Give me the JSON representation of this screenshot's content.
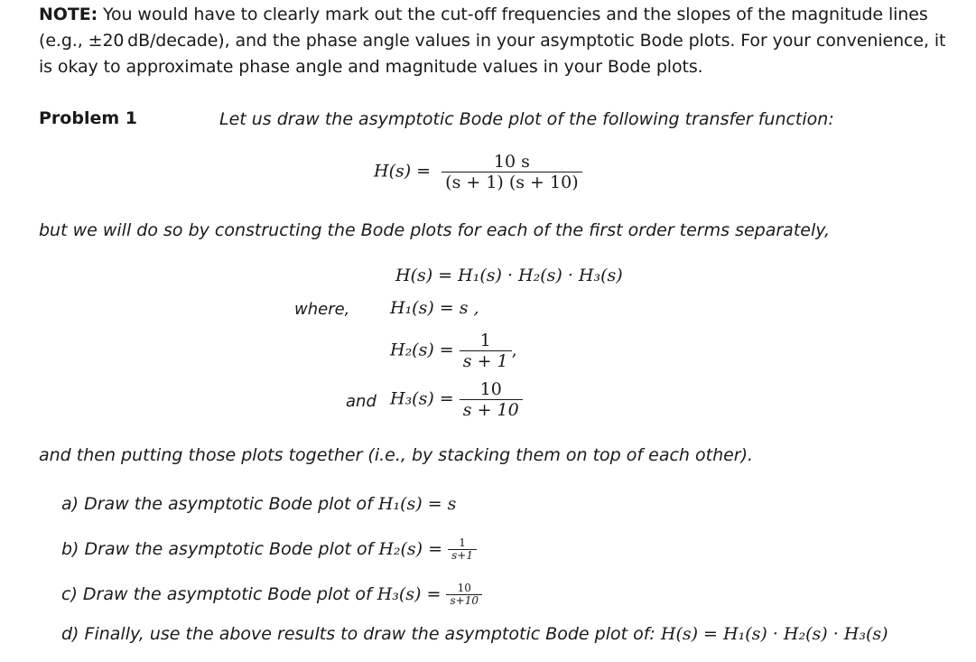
{
  "note": {
    "label": "NOTE:",
    "text": "You would have to clearly mark out the cut-off frequencies and the slopes of the magnitude lines (e.g., ±20 dB/decade), and the phase angle values in your asymptotic Bode plots. For your convenience, it is okay to approximate phase angle and magnitude values in your Bode plots."
  },
  "problem": {
    "label": "Problem 1",
    "intro": "Let us draw the asymptotic Bode plot of the following transfer function:",
    "main_eq": {
      "lhs": "H(s) =",
      "numerator": "10 s",
      "denominator": "(s + 1) (s + 10)"
    },
    "middle_text": "but we will do so by constructing the Bode plots for each of the first order terms separately,",
    "product_eq": "H(s) = H₁(s) · H₂(s) · H₃(s)",
    "where_label": "where,",
    "h1_eq": "H₁(s) = s ,",
    "h2": {
      "lhs": "H₂(s) =",
      "numerator": "1",
      "denominator": "s + 1",
      "suffix": ","
    },
    "and_label": "and",
    "h3": {
      "lhs": "H₃(s) =",
      "numerator": "10",
      "denominator": "s + 10"
    },
    "closing_text": "and then putting those plots together (i.e., by stacking them on top of each other).",
    "parts": [
      {
        "label": "a)",
        "text": "Draw the asymptotic Bode plot of",
        "math": "H₁(s) = s"
      },
      {
        "label": "b)",
        "text": "Draw the asymptotic Bode plot of",
        "math": "H₂(s) =",
        "numerator": "1",
        "denominator": "s+1"
      },
      {
        "label": "c)",
        "text": "Draw the asymptotic Bode plot of",
        "math": "H₃(s) =",
        "numerator": "10",
        "denominator": "s+10"
      },
      {
        "label": "d)",
        "text": "Finally, use the above results to draw the asymptotic Bode plot of:",
        "math": "H(s) = H₁(s) · H₂(s) · H₃(s)"
      }
    ]
  }
}
